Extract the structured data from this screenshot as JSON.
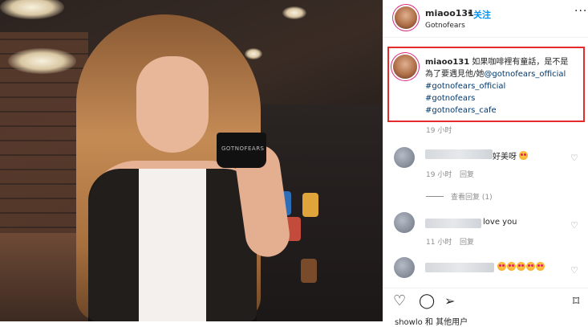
{
  "post": {
    "username": "miaoo131",
    "follow_label": "关注",
    "location": "Gotnofears",
    "more_label": "···",
    "cup_print": "GOTNOFEARS",
    "caption": {
      "text_line1": "如果咖啡裡有童話，是不是",
      "text_line2": "為了要遇見他/她",
      "mention": "@gotnofears_official",
      "tags": [
        "#gotnofears_official",
        "#gotnofears",
        "#gotnofears_cafe"
      ],
      "time": "19 小时"
    }
  },
  "comments": [
    {
      "text": "好美呀",
      "time": "19 小时",
      "reply": "回复",
      "emoji_count": 1
    },
    {
      "text": "love you",
      "time": "11 小时",
      "reply": "回复",
      "emoji_count": 0
    },
    {
      "text": "",
      "time": "",
      "reply": "",
      "emoji_count": 5
    }
  ],
  "view_replies": "查看回复 (1)",
  "actions": {
    "like_icon": "heart-icon",
    "comment_icon": "comment-icon",
    "share_icon": "share-icon",
    "save_icon": "bookmark-icon"
  },
  "likes_text": "showlo 和 其他用户"
}
